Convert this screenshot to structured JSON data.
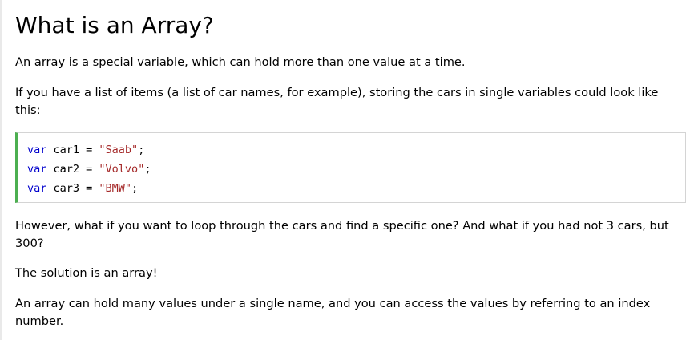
{
  "heading": "What is an Array?",
  "intro": "An array is a special variable, which can hold more than one value at a time.",
  "list_paragraph": "If you have a list of items (a list of car names, for example), storing the cars in single variables could look like this:",
  "code": {
    "lines": [
      {
        "keyword": "var",
        "name": " car1 = ",
        "string": "\"Saab\"",
        "end": ";"
      },
      {
        "keyword": "var",
        "name": " car2 = ",
        "string": "\"Volvo\"",
        "end": ";"
      },
      {
        "keyword": "var",
        "name": " car3 = ",
        "string": "\"BMW\"",
        "end": ";"
      }
    ],
    "keyword_color": "#0000cd",
    "string_color": "#a52a2a",
    "accent_color": "#4caf50"
  },
  "loop_paragraph": "However, what if you want to loop through the cars and find a specific one? And what if you had not 3 cars, but 300?",
  "solution": "The solution is an array!",
  "index_paragraph": "An array can hold many values under a single name, and you can access the values by referring to an index number."
}
